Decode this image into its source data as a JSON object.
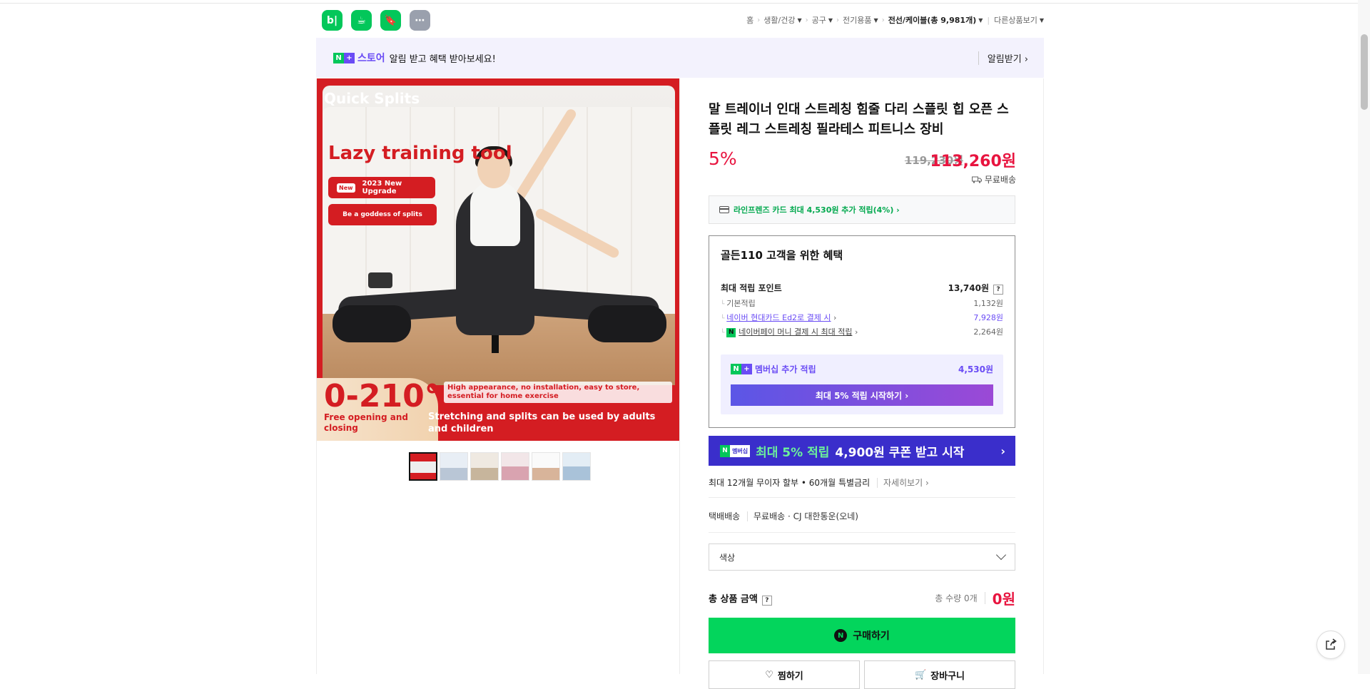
{
  "header": {
    "apps": [
      {
        "label": "b|",
        "icon": "blog-icon"
      },
      {
        "label": "☕",
        "icon": "cafe-icon"
      },
      {
        "label": "🔖",
        "icon": "bookmark-icon"
      },
      {
        "label": "⋯",
        "icon": "more-icon"
      }
    ],
    "breadcrumb": {
      "home": "홈",
      "cat1": "생활/건강",
      "cat2": "공구",
      "cat3": "전기용품",
      "current": "전선/케이블(총 9,981개)",
      "other": "다른상품보기"
    }
  },
  "store_banner": {
    "store_name": "스토어",
    "message": "알림 받고 혜택 받아보세요!",
    "alarm_label": "알림받기 ›"
  },
  "image": {
    "quick_splits": "Quick Splits",
    "lazy": "Lazy training tool",
    "new_tag": "New",
    "upgrade": "2023 New Upgrade",
    "goddess": "Be a goddess of splits",
    "degree": "0-210°",
    "free_open": "Free opening and closing",
    "high_appearance": "High appearance, no installation, easy to store, essential for home exercise",
    "stretching": "Stretching and splits can be used by adults and children"
  },
  "product": {
    "title": "말 트레이너 인대 스트레칭 힘줄 다리 스플릿 힙 오픈 스플릿 레그 스트레칭 필라테스 피트니스 장비",
    "discount": "5%",
    "original_price": "119,230원",
    "price": "113,260원",
    "shipping": "무료배송",
    "card_promo": "라인프렌즈 카드 최대 4,530원 추가 적립(4%) ›"
  },
  "benefit": {
    "heading": "골든110 고객을 위한 혜택",
    "max_points_label": "최대 적립 포인트",
    "max_points_value": "13,740원",
    "basic_label": "기본적립",
    "basic_value": "1,132원",
    "card_label": "네이버 현대카드 Ed2로 결제 시",
    "card_value": "7,928원",
    "pay_label": "네이버페이 머니 결제 시 최대 적립",
    "pay_value": "2,264원",
    "member_label": "멤버십 추가 적립",
    "member_value": "4,530원",
    "member_button": "최대 5% 적립 시작하기 ›"
  },
  "membership_banner": {
    "tag": "멤버십",
    "green_text": "최대 5% 적립",
    "white_text": "4,900원 쿠폰 받고 시작"
  },
  "installment": {
    "text": "최대 12개월 무이자 할부 • 60개월 특별금리",
    "more": "자세히보기 ›"
  },
  "delivery": {
    "type": "택배배송",
    "fee": "무료배송",
    "carrier": "· CJ 대한통운(오네)"
  },
  "option": {
    "placeholder": "색상"
  },
  "total": {
    "label": "총 상품 금액",
    "qty": "총 수량 0개",
    "amount": "0원"
  },
  "actions": {
    "buy": "구매하기",
    "wish": "찜하기",
    "cart": "장바구니"
  },
  "colors": {
    "naver_green": "#03c75a",
    "price_red": "#e8143f",
    "membership_purple": "#6a4cf5"
  }
}
